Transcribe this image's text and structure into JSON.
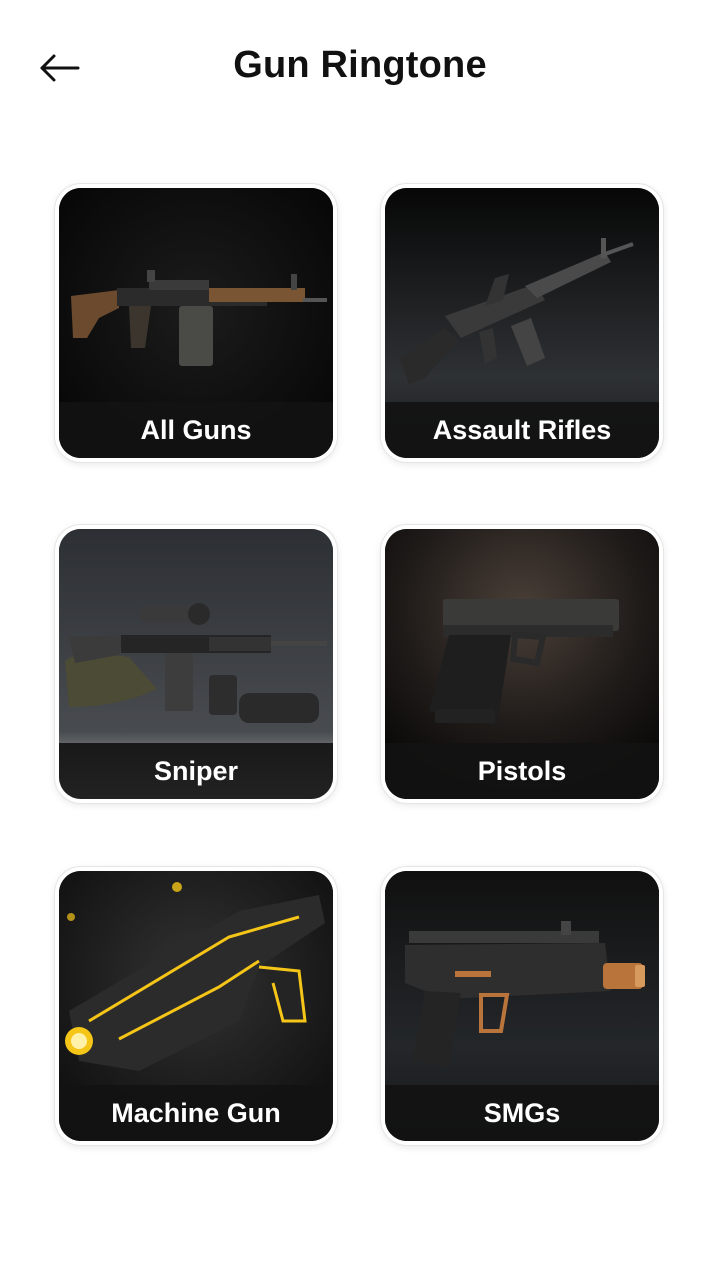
{
  "header": {
    "title": "Gun Ringtone",
    "back_icon": "arrow-left-icon"
  },
  "categories": [
    {
      "label": "All Guns",
      "icon": "rifle-image"
    },
    {
      "label": "Assault Rifles",
      "icon": "assault-rifle-image"
    },
    {
      "label": "Sniper",
      "icon": "sniper-rifle-image"
    },
    {
      "label": "Pistols",
      "icon": "pistol-image"
    },
    {
      "label": "Machine Gun",
      "icon": "machine-gun-image"
    },
    {
      "label": "SMGs",
      "icon": "smg-image"
    }
  ],
  "colors": {
    "background": "#ffffff",
    "title": "#111111",
    "card_label": "#ffffff",
    "glow_accent": "#f5c518",
    "copper_accent": "#b8743a"
  }
}
